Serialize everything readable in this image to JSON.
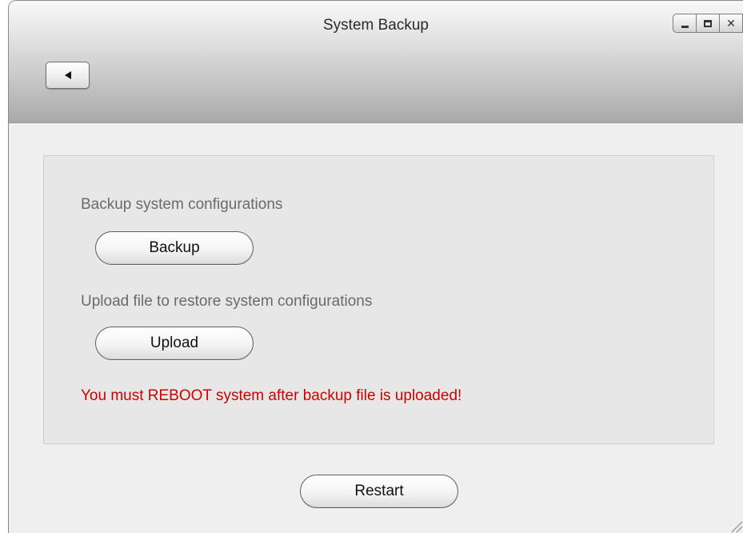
{
  "window": {
    "title": "System Backup",
    "controls": {
      "minimize": "minimize",
      "maximize": "maximize",
      "close": "✕"
    },
    "back_icon": "back-arrow-icon"
  },
  "backup": {
    "label": "Backup system configurations",
    "button": "Backup"
  },
  "upload": {
    "label": "Upload file to restore system configurations",
    "button": "Upload"
  },
  "warning": {
    "text": "You must REBOOT system after backup file is uploaded!",
    "color": "#cc0000"
  },
  "footer": {
    "restart_button": "Restart"
  }
}
